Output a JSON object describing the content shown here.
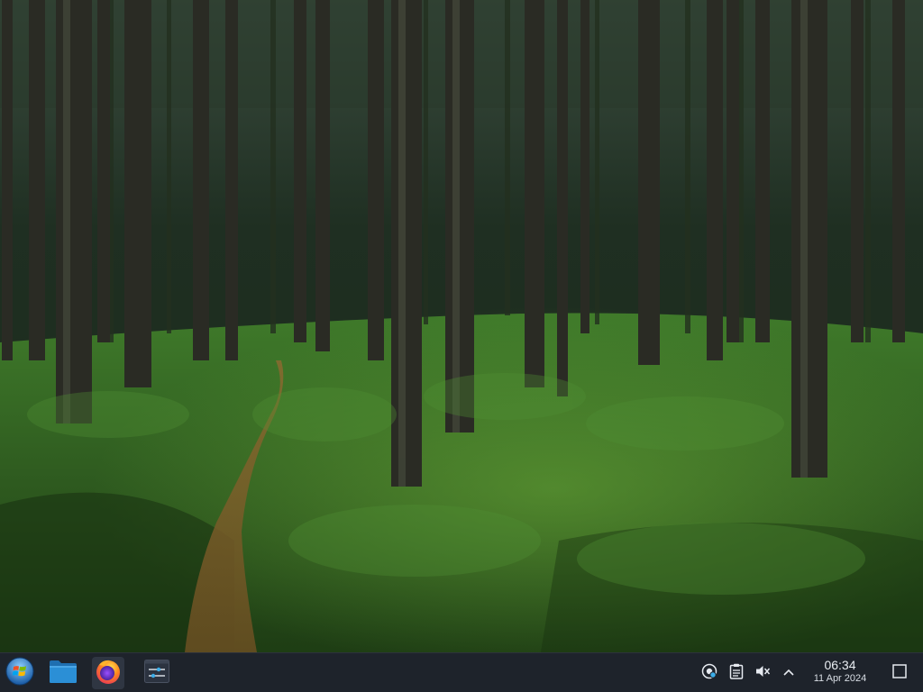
{
  "desktop": {
    "wallpaper": "forest-path-wallpaper"
  },
  "taskbar": {
    "start_icon": "start-orb-icon",
    "pinned": [
      {
        "name": "file-manager",
        "icon": "folder-icon"
      },
      {
        "name": "firefox",
        "icon": "firefox-icon"
      },
      {
        "name": "settings",
        "icon": "settings-sliders-icon"
      }
    ],
    "tray": {
      "icons": [
        "network-icon",
        "clipboard-icon",
        "volume-muted-icon",
        "chevron-up-icon"
      ],
      "time": "06:34",
      "date": "11 Apr 2024",
      "show_desktop_icon": "show-desktop-icon"
    }
  },
  "colors": {
    "taskbar_bg": "#1e232b",
    "folder_blue": "#2b8fd6",
    "clock_text": "#e9edf2"
  }
}
